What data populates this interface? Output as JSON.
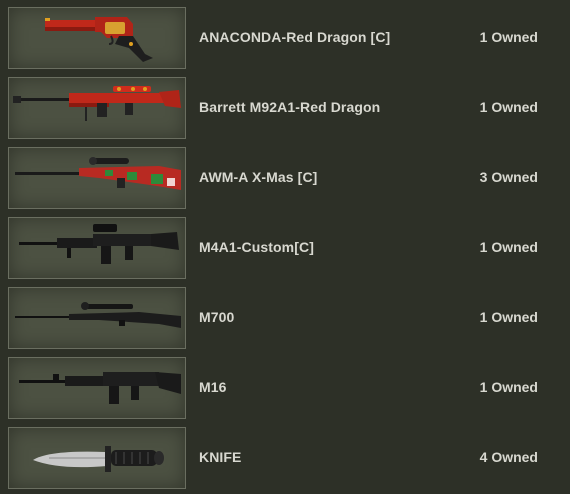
{
  "inventory": {
    "items": [
      {
        "name": "ANACONDA-Red Dragon [C]",
        "owned": "1 Owned",
        "icon": "revolver-red-dragon-icon"
      },
      {
        "name": "Barrett M92A1-Red Dragon",
        "owned": "1 Owned",
        "icon": "barrett-sniper-red-dragon-icon"
      },
      {
        "name": "AWM-A X-Mas [C]",
        "owned": "3 Owned",
        "icon": "awm-xmas-sniper-icon"
      },
      {
        "name": "M4A1-Custom[C]",
        "owned": "1 Owned",
        "icon": "m4a1-custom-rifle-icon"
      },
      {
        "name": "M700",
        "owned": "1 Owned",
        "icon": "m700-sniper-icon"
      },
      {
        "name": "M16",
        "owned": "1 Owned",
        "icon": "m16-rifle-icon"
      },
      {
        "name": "KNIFE",
        "owned": "4 Owned",
        "icon": "knife-icon"
      }
    ]
  },
  "colors": {
    "background": "#2d3027",
    "thumbnail_bg": "#4c5142",
    "text": "#d8d8d0",
    "red_dragon": "#c0281a",
    "gold_trim": "#e0a020",
    "xmas_green": "#2e8a3a"
  }
}
